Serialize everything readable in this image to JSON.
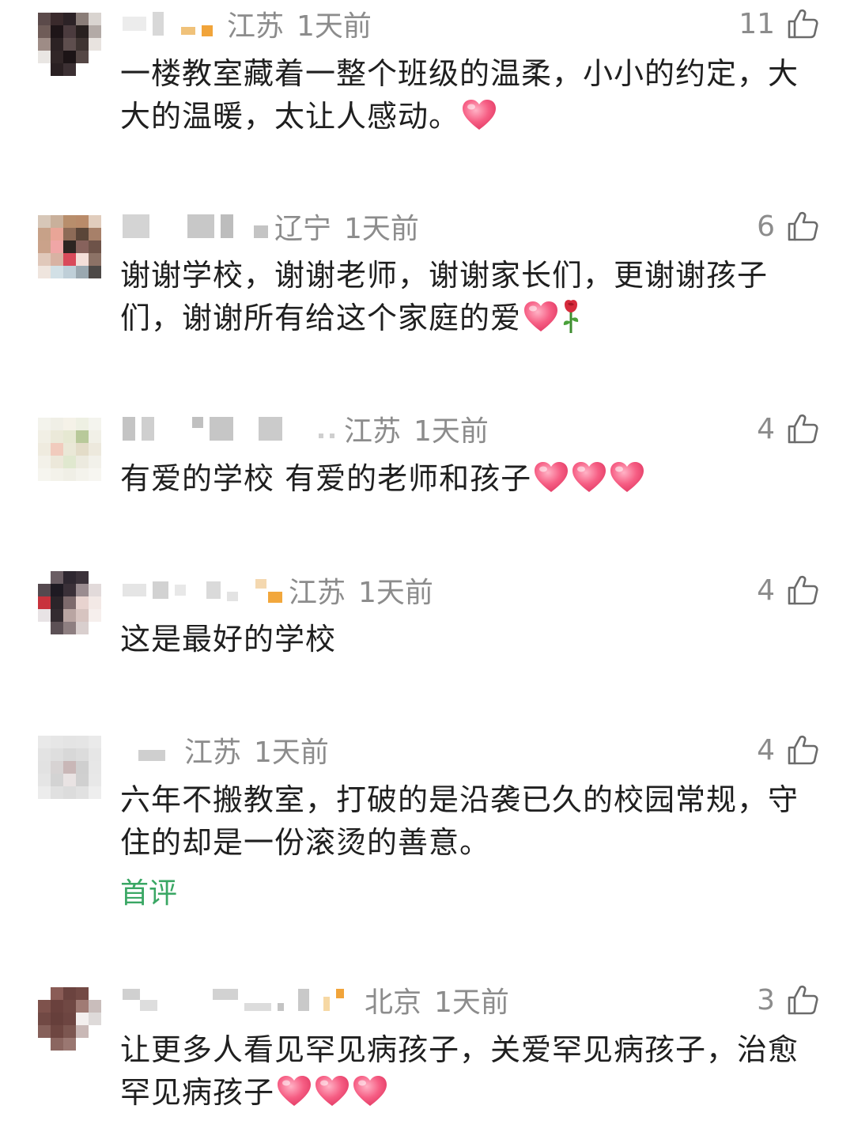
{
  "comments": [
    {
      "location": "江苏",
      "time": "1天前",
      "likes": "11",
      "text": "一楼教室藏着一整个班级的温柔，小小的约定，大大的温暖，太让人感动。",
      "emojis": [
        "red-heart"
      ]
    },
    {
      "location": "辽宁",
      "time": "1天前",
      "likes": "6",
      "text": "谢谢学校，谢谢老师，谢谢家长们，更谢谢孩子们，谢谢所有给这个家庭的爱",
      "emojis": [
        "red-heart",
        "rose"
      ]
    },
    {
      "location": "江苏",
      "time": "1天前",
      "likes": "4",
      "text": "有爱的学校 有爱的老师和孩子",
      "emojis": [
        "red-heart",
        "red-heart",
        "red-heart"
      ]
    },
    {
      "location": "江苏",
      "time": "1天前",
      "likes": "4",
      "text": "这是最好的学校",
      "emojis": []
    },
    {
      "location": "江苏",
      "time": "1天前",
      "likes": "4",
      "text": "六年不搬教室，打破的是沿袭已久的校园常规，守住的却是一份滚烫的善意。",
      "emojis": [],
      "tag": "首评"
    },
    {
      "location": "北京",
      "time": "1天前",
      "likes": "3",
      "text": "让更多人看见罕见病孩子，关爱罕见病孩子，治愈罕见病孩子",
      "emojis": [
        "red-heart",
        "red-heart",
        "red-heart"
      ]
    }
  ],
  "colors": {
    "meta_gray": "#8c8c8c",
    "tag_green": "#3aa764",
    "heart_pink": "#f2557a"
  },
  "icons": {
    "like": "thumbs-up-icon"
  }
}
